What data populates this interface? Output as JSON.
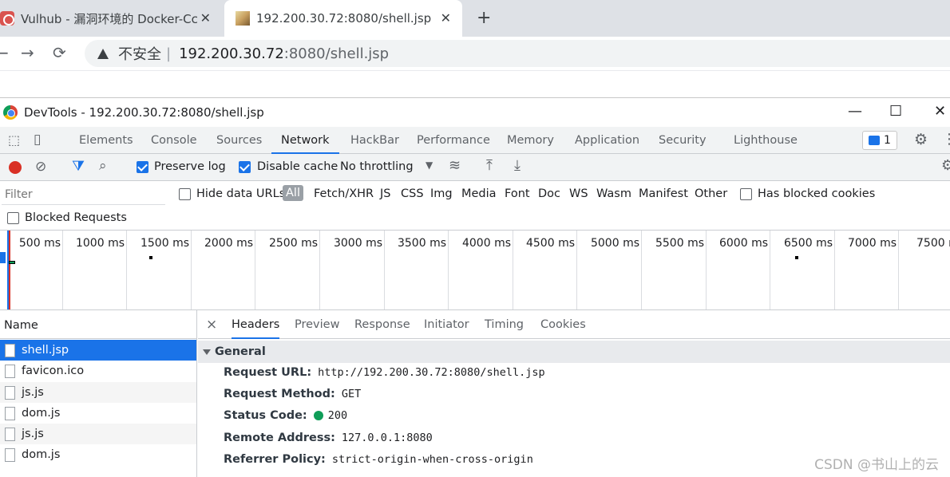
{
  "browser": {
    "tabs": [
      {
        "title": "Vulhub - 漏洞环境的 Docker-Cc",
        "close": "✕"
      },
      {
        "title": "192.200.30.72:8080/shell.jsp",
        "close": "✕"
      }
    ],
    "new_tab": "+",
    "nav": {
      "back": "←",
      "forward": "→",
      "reload": "⟳"
    },
    "address": {
      "insecure_label": "不安全",
      "separator": "|",
      "host": "192.200.30.72",
      "path": ":8080/shell.jsp"
    }
  },
  "devtools": {
    "window_title": "DevTools - 192.200.30.72:8080/shell.jsp",
    "window_controls": {
      "minimize": "—",
      "maximize": "☐",
      "close": "✕"
    },
    "tabs": [
      "Elements",
      "Console",
      "Sources",
      "Network",
      "HackBar",
      "Performance",
      "Memory",
      "Application",
      "Security",
      "Lighthouse"
    ],
    "active_tab": "Network",
    "issues_count": "1",
    "toolbar": {
      "preserve_log": "Preserve log",
      "disable_cache": "Disable cache",
      "throttling": "No throttling",
      "preserve_log_checked": true,
      "disable_cache_checked": true
    },
    "filter": {
      "placeholder": "Filter",
      "hide_data_urls": "Hide data URLs",
      "types": [
        "All",
        "Fetch/XHR",
        "JS",
        "CSS",
        "Img",
        "Media",
        "Font",
        "Doc",
        "WS",
        "Wasm",
        "Manifest",
        "Other"
      ],
      "has_blocked_cookies": "Has blocked cookies",
      "blocked_requests": "Blocked Requests"
    },
    "timeline": {
      "ticks": [
        "500 ms",
        "1000 ms",
        "1500 ms",
        "2000 ms",
        "2500 ms",
        "3000 ms",
        "3500 ms",
        "4000 ms",
        "4500 ms",
        "5000 ms",
        "5500 ms",
        "6000 ms",
        "6500 ms",
        "7000 ms",
        "7500 m"
      ]
    },
    "requests": {
      "header": "Name",
      "items": [
        "shell.jsp",
        "favicon.ico",
        "js.js",
        "dom.js",
        "js.js",
        "dom.js"
      ],
      "selected": "shell.jsp"
    },
    "detail": {
      "close": "×",
      "tabs": [
        "Headers",
        "Preview",
        "Response",
        "Initiator",
        "Timing",
        "Cookies"
      ],
      "active_tab": "Headers",
      "section": "General",
      "fields": [
        {
          "key": "Request URL:",
          "value": "http://192.200.30.72:8080/shell.jsp"
        },
        {
          "key": "Request Method:",
          "value": "GET"
        },
        {
          "key": "Status Code:",
          "value": "200"
        },
        {
          "key": "Remote Address:",
          "value": "127.0.0.1:8080"
        },
        {
          "key": "Referrer Policy:",
          "value": "strict-origin-when-cross-origin"
        }
      ]
    }
  },
  "watermark": "CSDN @书山上的云",
  "colors": {
    "accent": "#1a73e8",
    "record": "#d93025",
    "status_ok": "#0f9d58"
  }
}
